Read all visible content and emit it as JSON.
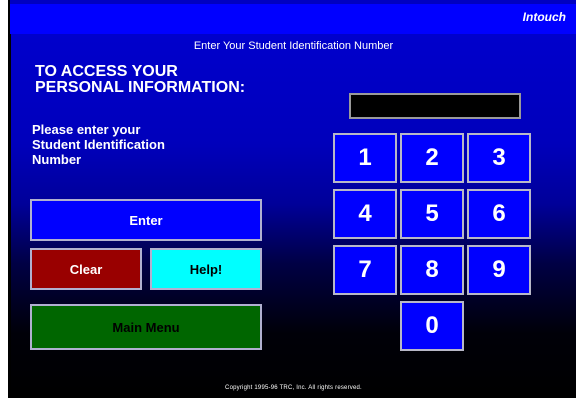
{
  "app": {
    "brand": "Intouch"
  },
  "header": {
    "title": "Enter Your Student Identification Number"
  },
  "main": {
    "access_heading": "TO ACCESS YOUR\nPERSONAL INFORMATION:",
    "prompt": "Please enter your\nStudent Identification\nNumber",
    "id_field_value": ""
  },
  "buttons": {
    "enter": "Enter",
    "clear": "Clear",
    "help": "Help!",
    "main_menu": "Main Menu"
  },
  "keypad": {
    "k1": "1",
    "k2": "2",
    "k3": "3",
    "k4": "4",
    "k5": "5",
    "k6": "6",
    "k7": "7",
    "k8": "8",
    "k9": "9",
    "k0": "0"
  },
  "footer": {
    "copyright": "Copyright 1995-96 TRC, Inc. All rights reserved."
  },
  "colors": {
    "screen_blue": "#0000ff",
    "clear_red": "#990000",
    "help_cyan": "#00ffff",
    "main_menu_green": "#006600"
  }
}
